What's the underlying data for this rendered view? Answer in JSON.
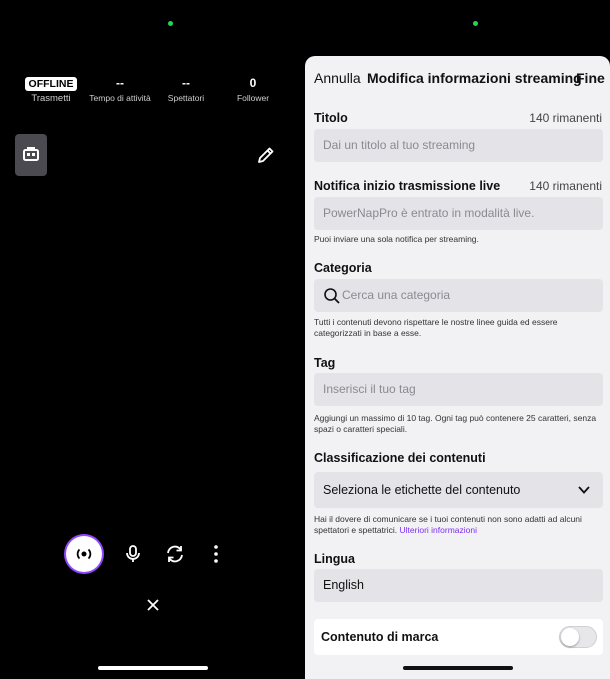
{
  "broadcast": {
    "status_badge": "OFFLINE",
    "stats": [
      {
        "value": "",
        "label": "Trasmetti"
      },
      {
        "value": "--",
        "label": "Tempo di attività"
      },
      {
        "value": "--",
        "label": "Spettatori"
      },
      {
        "value": "0",
        "label": "Follower"
      }
    ],
    "icons": {
      "badge": "stream-manager-icon",
      "edit": "pencil-icon",
      "go_live": "broadcast-icon",
      "mic": "microphone-icon",
      "flip": "camera-flip-icon",
      "more": "more-vertical-icon",
      "close": "close-icon"
    },
    "accent": "#9147ff"
  },
  "stream_info": {
    "header": {
      "cancel": "Annulla",
      "title": "Modifica informazioni streaming",
      "done": "Fine"
    },
    "title_section": {
      "label": "Titolo",
      "remaining": "140 rimanenti",
      "placeholder": "Dai un titolo al tuo streaming"
    },
    "notification_section": {
      "label": "Notifica inizio trasmissione live",
      "remaining": "140 rimanenti",
      "placeholder": "PowerNapPro è entrato in modalità live.",
      "help": "Puoi inviare una sola notifica per streaming."
    },
    "category_section": {
      "label": "Categoria",
      "placeholder": "Cerca una categoria",
      "help": "Tutti i contenuti devono rispettare le nostre linee guida ed essere categorizzati in base a esse."
    },
    "tag_section": {
      "label": "Tag",
      "placeholder": "Inserisci il tuo tag",
      "help": "Aggiungi un massimo di 10 tag. Ogni tag può contenere 25 caratteri, senza spazi o caratteri speciali."
    },
    "classification_section": {
      "label": "Classificazione dei contenuti",
      "select_value": "Seleziona le etichette del contenuto",
      "help": "Hai il dovere di comunicare se i tuoi contenuti non sono adatti ad alcuni spettatori e spettatrici.",
      "help_link": "Ulteriori informazioni"
    },
    "language_section": {
      "label": "Lingua",
      "value": "English"
    },
    "branded_content": {
      "label": "Contenuto di marca",
      "enabled": false
    },
    "link_color": "#7d2ff4"
  }
}
